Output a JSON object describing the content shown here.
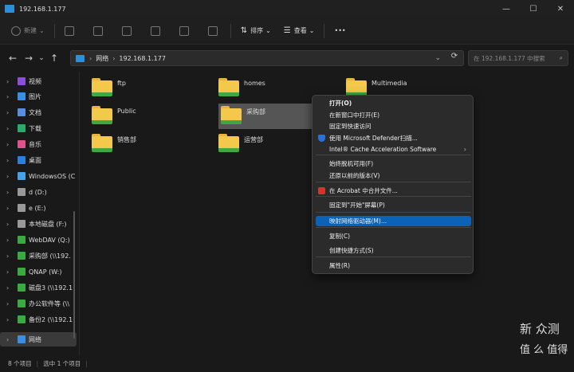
{
  "window": {
    "title": "192.168.1.177"
  },
  "toolbar": {
    "new_label": "新建",
    "sort_label": "排序",
    "view_label": "查看",
    "more_label": "•••"
  },
  "nav": {
    "back": "←",
    "forward": "→",
    "recent": "⌄",
    "up": "↑"
  },
  "address": {
    "crumb_network": "网络",
    "crumb_host": "192.168.1.177",
    "search_placeholder": "在 192.168.1.177 中搜索"
  },
  "sidebar": {
    "items": [
      {
        "label": "视频",
        "color": "#8a4fd8"
      },
      {
        "label": "图片",
        "color": "#3a8fe0"
      },
      {
        "label": "文档",
        "color": "#5a8ce0"
      },
      {
        "label": "下载",
        "color": "#2fa86b"
      },
      {
        "label": "音乐",
        "color": "#e0528a"
      },
      {
        "label": "桌面",
        "color": "#2f7fd8"
      },
      {
        "label": "WindowsOS (C",
        "color": "#4aa0e8"
      },
      {
        "label": "d (D:)",
        "color": "#999999"
      },
      {
        "label": "e (E:)",
        "color": "#999999"
      },
      {
        "label": "本地磁盘 (F:)",
        "color": "#999999"
      },
      {
        "label": "WebDAV (Q:)",
        "color": "#3ea842"
      },
      {
        "label": "采购部 (\\\\192.",
        "color": "#3ea842"
      },
      {
        "label": "QNAP (W:)",
        "color": "#3ea842"
      },
      {
        "label": "磁盘3 (\\\\192.1",
        "color": "#3ea842"
      },
      {
        "label": "办公软件等 (\\\\",
        "color": "#3ea842"
      },
      {
        "label": "备份2 (\\\\192.1",
        "color": "#3ea842"
      },
      {
        "label": "网络",
        "color": "#3a8fe0"
      }
    ]
  },
  "folders": [
    {
      "name": "ftp"
    },
    {
      "name": "homes"
    },
    {
      "name": "Multimedia"
    },
    {
      "name": "Public"
    },
    {
      "name": "采购部"
    },
    {
      "name": "销售部"
    },
    {
      "name": "运营部"
    }
  ],
  "context_menu": {
    "items": [
      {
        "label": "打开(O)"
      },
      {
        "label": "在新窗口中打开(E)"
      },
      {
        "label": "固定到快速访问"
      },
      {
        "label": "使用 Microsoft Defender扫描..."
      },
      {
        "label": "Intel® Cache Acceleration Software"
      },
      {
        "label": "始终脱机可用(F)"
      },
      {
        "label": "还原以前的版本(V)"
      },
      {
        "label": "在 Acrobat 中合并文件..."
      },
      {
        "label": "固定到\"开始\"屏幕(P)"
      },
      {
        "label": "映射网络驱动器(M)..."
      },
      {
        "label": "复制(C)"
      },
      {
        "label": "创建快捷方式(S)"
      },
      {
        "label": "属性(R)"
      }
    ],
    "submenu_arrow": "›"
  },
  "status": {
    "item_count": "8 个项目",
    "selected": "选中 1 个项目"
  },
  "watermark": {
    "line1": "新 众测",
    "line2": "值 么 值得"
  },
  "colors": {
    "accent": "#0a63b8",
    "folder": "#f3c84b",
    "share_bar": "#3ea842"
  }
}
